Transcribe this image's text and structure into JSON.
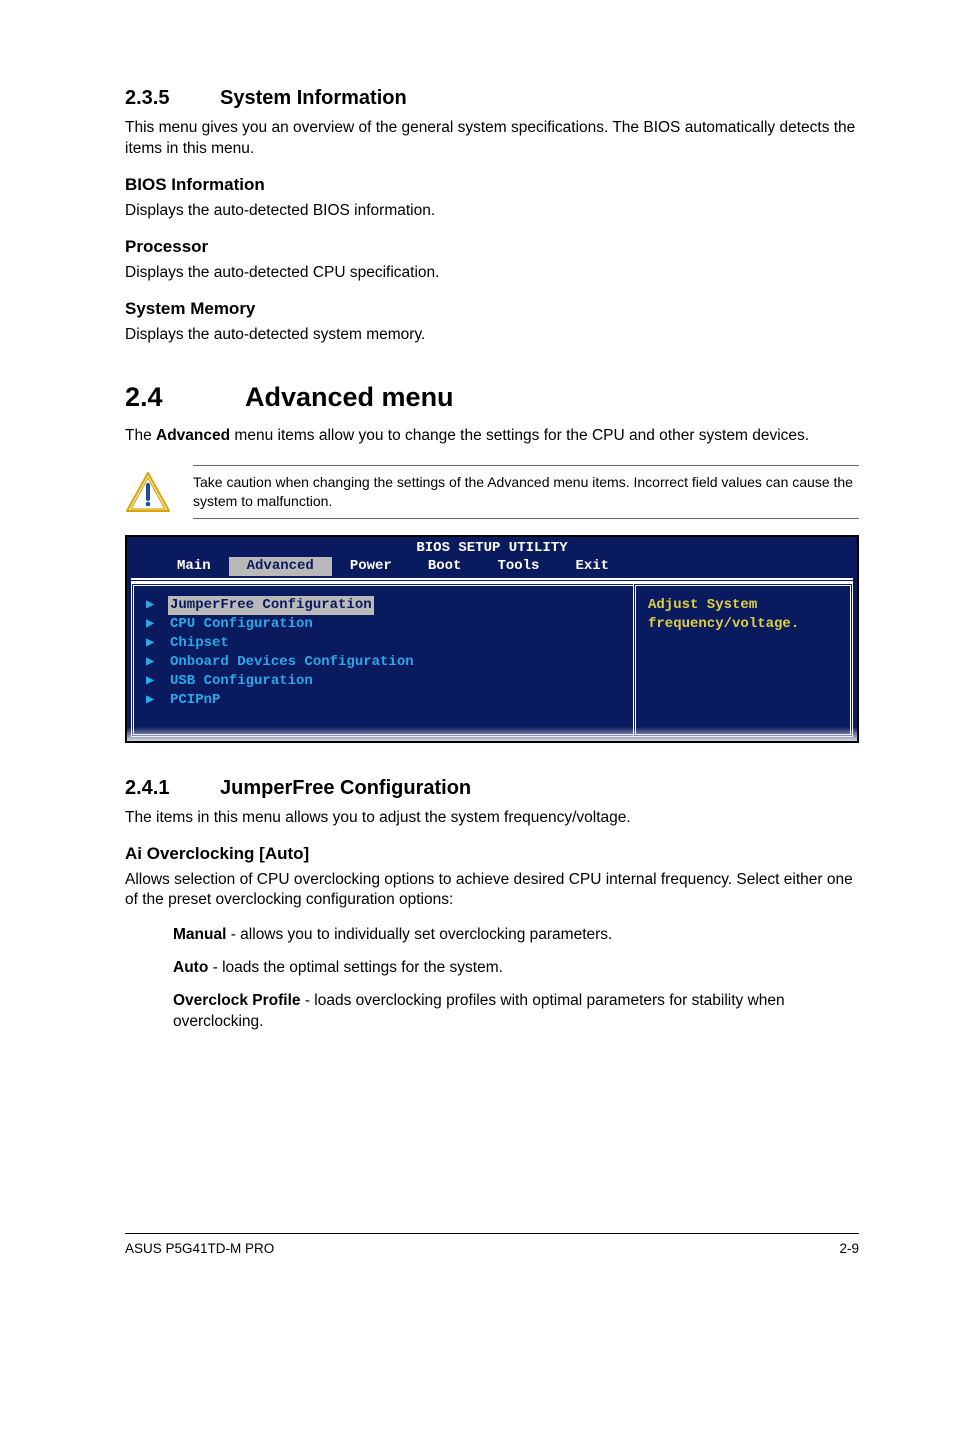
{
  "sec235": {
    "num": "2.3.5",
    "title": "System Information",
    "intro": "This menu gives you an overview of the general system specifications. The BIOS automatically detects the items in this menu.",
    "bios_info_h": "BIOS Information",
    "bios_info_p": "Displays the auto-detected BIOS information.",
    "proc_h": "Processor",
    "proc_p": "Displays the auto-detected CPU specification.",
    "mem_h": "System Memory",
    "mem_p": "Displays the auto-detected system memory."
  },
  "sec24": {
    "num": "2.4",
    "title": "Advanced menu",
    "intro_pre": "The ",
    "intro_b": "Advanced",
    "intro_post": " menu items allow you to change the settings for the CPU and other system devices.",
    "callout": "Take caution when changing the settings of the Advanced menu items. Incorrect field values can cause the system to malfunction."
  },
  "bios": {
    "title": "BIOS SETUP UTILITY",
    "tabs": [
      "Main",
      "Advanced",
      "Power",
      "Boot",
      "Tools",
      "Exit"
    ],
    "active_tab": 1,
    "items": [
      "JumperFree Configuration",
      "CPU Configuration",
      "Chipset",
      "Onboard Devices Configuration",
      "USB Configuration",
      "PCIPnP"
    ],
    "selected_item": 0,
    "help1": "Adjust System",
    "help2": "frequency/voltage."
  },
  "sec241": {
    "num": "2.4.1",
    "title": "JumperFree Configuration",
    "intro": "The items in this menu allows you to adjust the system frequency/voltage.",
    "ai_h": "Ai Overclocking [Auto]",
    "ai_p": "Allows selection of CPU overclocking options to achieve desired CPU internal frequency. Select either one of the preset overclocking configuration options:",
    "opts": [
      {
        "b": "Manual",
        "t": " - allows you to individually set overclocking parameters."
      },
      {
        "b": "Auto",
        "t": " - loads the optimal settings for the system."
      },
      {
        "b": "Overclock Profile",
        "t": " - loads overclocking profiles with optimal parameters for stability when overclocking."
      }
    ]
  },
  "footer": {
    "left": "ASUS P5G41TD-M PRO",
    "right": "2-9"
  }
}
